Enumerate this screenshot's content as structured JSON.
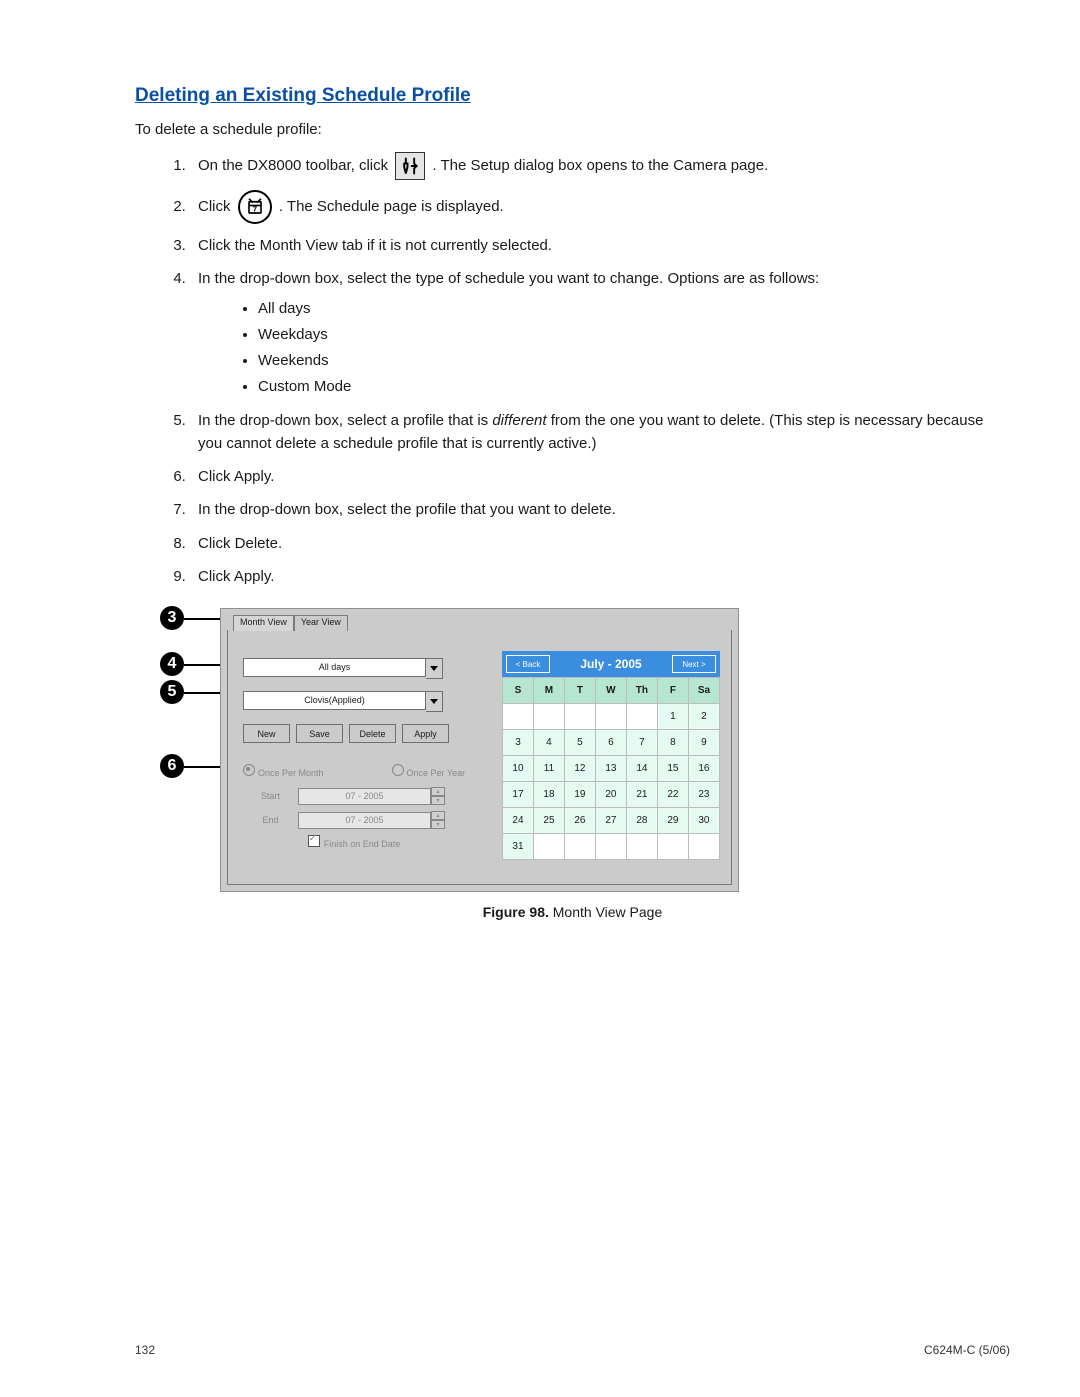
{
  "title": "Deleting an Existing Schedule Profile",
  "intro": "To delete a schedule profile:",
  "s1a": "On the DX8000 toolbar, click ",
  "s1b": ". The Setup dialog box opens to the Camera page.",
  "s2a": "Click ",
  "s2b": ". The Schedule page is displayed.",
  "s3": "Click the Month View tab if it is not currently selected.",
  "s4": "In the drop-down box, select the type of schedule you want to change. Options are as follows:",
  "opts": {
    "a": "All days",
    "b": "Weekdays",
    "c": "Weekends",
    "d": "Custom Mode"
  },
  "s5a": "In the drop-down box, select a profile that is ",
  "s5i": "different ",
  "s5b": "from the one you want to delete. (This step is necessary because you cannot delete a schedule profile that is currently active.)",
  "s6": "Click Apply.",
  "s7": "In the drop-down box, select the profile that you want to delete.",
  "s8": "Click Delete.",
  "s9": "Click Apply.",
  "ui": {
    "tab1": "Month View",
    "tab2": "Year View",
    "combo1": "All days",
    "combo2": "Clovis(Applied)",
    "btn_new": "New",
    "btn_save": "Save",
    "btn_delete": "Delete",
    "btn_apply": "Apply",
    "rad1": "Once Per Month",
    "rad2": "Once Per Year",
    "lbl_start": "Start",
    "lbl_end": "End",
    "date_start": "07 - 2005",
    "date_end": "07 - 2005",
    "chk_finish": "Finish on End Date",
    "cal_back": "< Back",
    "cal_next": "Next >",
    "cal_title": "July - 2005",
    "wd": {
      "s": "S",
      "m": "M",
      "t": "T",
      "w": "W",
      "th": "Th",
      "f": "F",
      "sa": "Sa"
    }
  },
  "callouts": {
    "c3": "3",
    "c4": "4",
    "c5": "5",
    "c6": "6"
  },
  "figcap_b": "Figure 98.",
  "figcap_t": "  Month View Page",
  "page_no": "132",
  "doc_id": "C624M-C (5/06)"
}
